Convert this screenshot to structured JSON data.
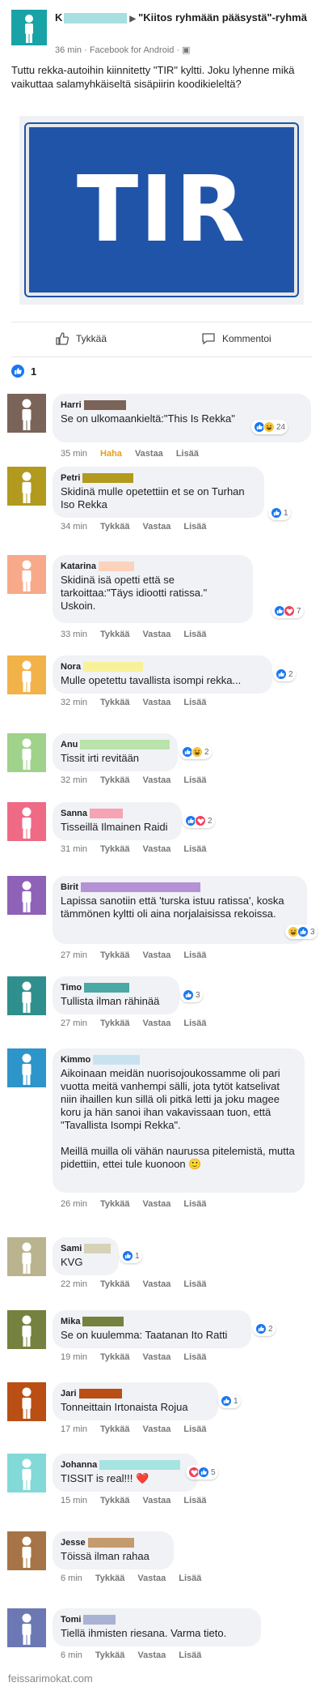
{
  "post": {
    "author_initial": "K",
    "group": "\"Kiitos ryhmään pääsystä\"-ryhmä",
    "time": "36 min",
    "source": "· Facebook for Android ·",
    "text": "Tuttu rekka-autoihin kiinnitetty \"TIR\" kyltti. Joku lyhenne mikä vaikuttaa salamyhkäiseltä sisäpiirin koodikieleltä?",
    "sign_text": "TIR",
    "like_label": "Tykkää",
    "comment_label": "Kommentoi",
    "like_count": "1",
    "avatar_color": "#19a3a6"
  },
  "comments": [
    {
      "name": "Harri",
      "text": "Se on ulkomaankieltä:\"This Is Rekka\"",
      "time": "35 min",
      "like": "Haha",
      "reply": "Vastaa",
      "more": "Lisää",
      "reactions": [
        "like",
        "haha"
      ],
      "count": "24",
      "color": "#7a6358",
      "blur": "#7a6358"
    },
    {
      "name": "Petri",
      "text": "Skidinä mulle opetettiin et se on Turhan Iso Rekka",
      "time": "34 min",
      "like": "Tykkää",
      "reply": "Vastaa",
      "more": "Lisää",
      "reactions": [
        "like"
      ],
      "count": "1",
      "color": "#b19a1d",
      "blur": "#b19a1d"
    },
    {
      "name": "Katarina",
      "text": "Skidinä isä opetti että se tarkoittaa:\"Täys idiootti ratissa.\" Uskoin.",
      "time": "33 min",
      "like": "Tykkää",
      "reply": "Vastaa",
      "more": "Lisää",
      "reactions": [
        "like",
        "love"
      ],
      "count": "7",
      "color": "#f7a98a",
      "blur": "#fcd2bd"
    },
    {
      "name": "Nora",
      "text": "Mulle opetettu tavallista isompi rekka...",
      "time": "32 min",
      "like": "Tykkää",
      "reply": "Vastaa",
      "more": "Lisää",
      "reactions": [
        "like"
      ],
      "count": "2",
      "color": "#f2b24a",
      "blur": "#f9f19a"
    },
    {
      "name": "Anu",
      "text": "Tissit irti revitään",
      "time": "32 min",
      "like": "Tykkää",
      "reply": "Vastaa",
      "more": "Lisää",
      "reactions": [
        "like",
        "haha"
      ],
      "count": "2",
      "color": "#9fd28a",
      "blur": "#b9e3aa"
    },
    {
      "name": "Sanna",
      "text": "Tisseillä Ilmainen Raidi",
      "time": "31 min",
      "like": "Tykkää",
      "reply": "Vastaa",
      "more": "Lisää",
      "reactions": [
        "like",
        "love"
      ],
      "count": "2",
      "color": "#ee6a85",
      "blur": "#f6a3b4"
    },
    {
      "name": "Birit",
      "text": "Lapissa sanotiin että 'turska istuu ratissa', koska tämmönen kyltti oli aina norjalaisissa rekoissa.",
      "time": "27 min",
      "like": "Tykkää",
      "reply": "Vastaa",
      "more": "Lisää",
      "reactions": [
        "haha",
        "like"
      ],
      "count": "3",
      "color": "#8e62b6",
      "blur": "#b591d6"
    },
    {
      "name": "Timo",
      "text": "Tullista ilman rähinää",
      "time": "27 min",
      "like": "Tykkää",
      "reply": "Vastaa",
      "more": "Lisää",
      "reactions": [
        "like"
      ],
      "count": "3",
      "color": "#2f8f8d",
      "blur": "#4aa8a5"
    },
    {
      "name": "Kimmo",
      "text": "Aikoinaan meidän nuorisojoukossamme oli pari vuotta meitä vanhempi sälli, jota tytöt katselivat niin ihaillen kun sillä oli pitkä letti ja joku magee koru ja hän sanoi ihan vakavissaan tuon, että \"Tavallista Isompi Rekka\".\n\nMeillä muilla oli vähän naurussa pitelemistä, mutta pidettiin, ettei tule kuonoon 🙂",
      "time": "26 min",
      "like": "Tykkää",
      "reply": "Vastaa",
      "more": "Lisää",
      "reactions": [],
      "count": "",
      "color": "#2d95c9",
      "blur": "#c8e2f0"
    },
    {
      "name": "Sami",
      "text": "KVG",
      "time": "22 min",
      "like": "Tykkää",
      "reply": "Vastaa",
      "more": "Lisää",
      "reactions": [
        "like"
      ],
      "count": "1",
      "color": "#b9b38e",
      "blur": "#d6d2b8"
    },
    {
      "name": "Mika",
      "text": "Se on kuulemma: Taatanan Ito Ratti",
      "time": "19 min",
      "like": "Tykkää",
      "reply": "Vastaa",
      "more": "Lisää",
      "reactions": [
        "like"
      ],
      "count": "2",
      "color": "#74813f",
      "blur": "#74813f"
    },
    {
      "name": "Jari",
      "text": "Tonneittain Irtonaista Rojua",
      "time": "17 min",
      "like": "Tykkää",
      "reply": "Vastaa",
      "more": "Lisää",
      "reactions": [
        "like"
      ],
      "count": "1",
      "color": "#b94f14",
      "blur": "#b94f14"
    },
    {
      "name": "Johanna",
      "text": "TISSIT is real!!! ❤️",
      "time": "15 min",
      "like": "Tykkää",
      "reply": "Vastaa",
      "more": "Lisää",
      "reactions": [
        "love",
        "like"
      ],
      "count": "5",
      "color": "#83d8d8",
      "blur": "#a6e4e1"
    },
    {
      "name": "Jesse",
      "text": "Töissä ilman rahaa",
      "time": "6 min",
      "like": "Tykkää",
      "reply": "Vastaa",
      "more": "Lisää",
      "reactions": [],
      "count": "",
      "color": "#a67446",
      "blur": "#c49a6f"
    },
    {
      "name": "Tomi",
      "text": "Tiellä ihmisten riesana. Varma tieto.",
      "time": "6 min",
      "like": "Tykkää",
      "reply": "Vastaa",
      "more": "Lisää",
      "reactions": [],
      "count": "",
      "color": "#6b78b3",
      "blur": "#a9b2d4"
    }
  ],
  "watermark": "feissarimokat.com"
}
